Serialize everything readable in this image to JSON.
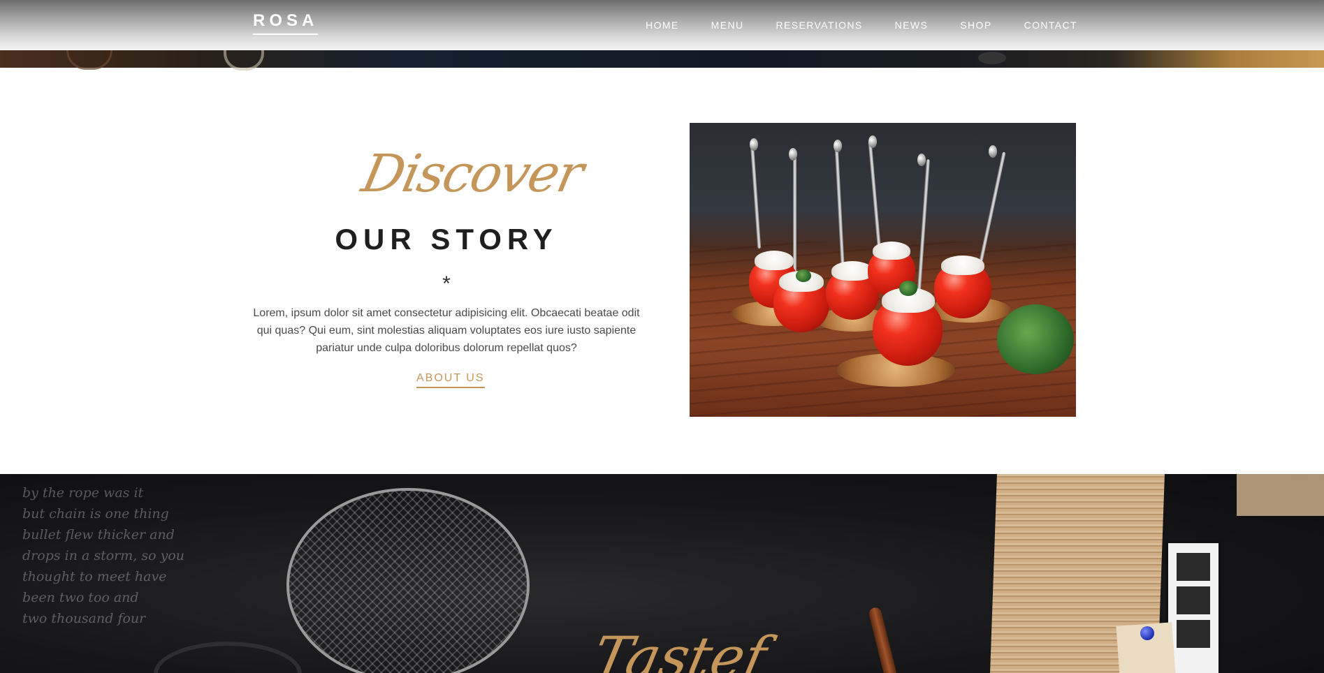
{
  "header": {
    "logo": "ROSA",
    "nav": [
      "HOME",
      "MENU",
      "RESERVATIONS",
      "NEWS",
      "SHOP",
      "CONTACT"
    ]
  },
  "story": {
    "script_title": "Discover",
    "title": "OUR STORY",
    "divider": "*",
    "text": "Lorem, ipsum dolor sit amet consectetur adipisicing elit. Obcaecati beatae odit qui quas? Qui eum, sint molestias aliquam voluptates eos iure iusto sapiente pariatur unde culpa doloribus dolorum repellat quos?",
    "link": "ABOUT US"
  },
  "next_section": {
    "script_title": "Tastef"
  },
  "colors": {
    "accent": "#c4965a",
    "title": "#1f1f1f",
    "body_text": "#4a4a4a"
  }
}
